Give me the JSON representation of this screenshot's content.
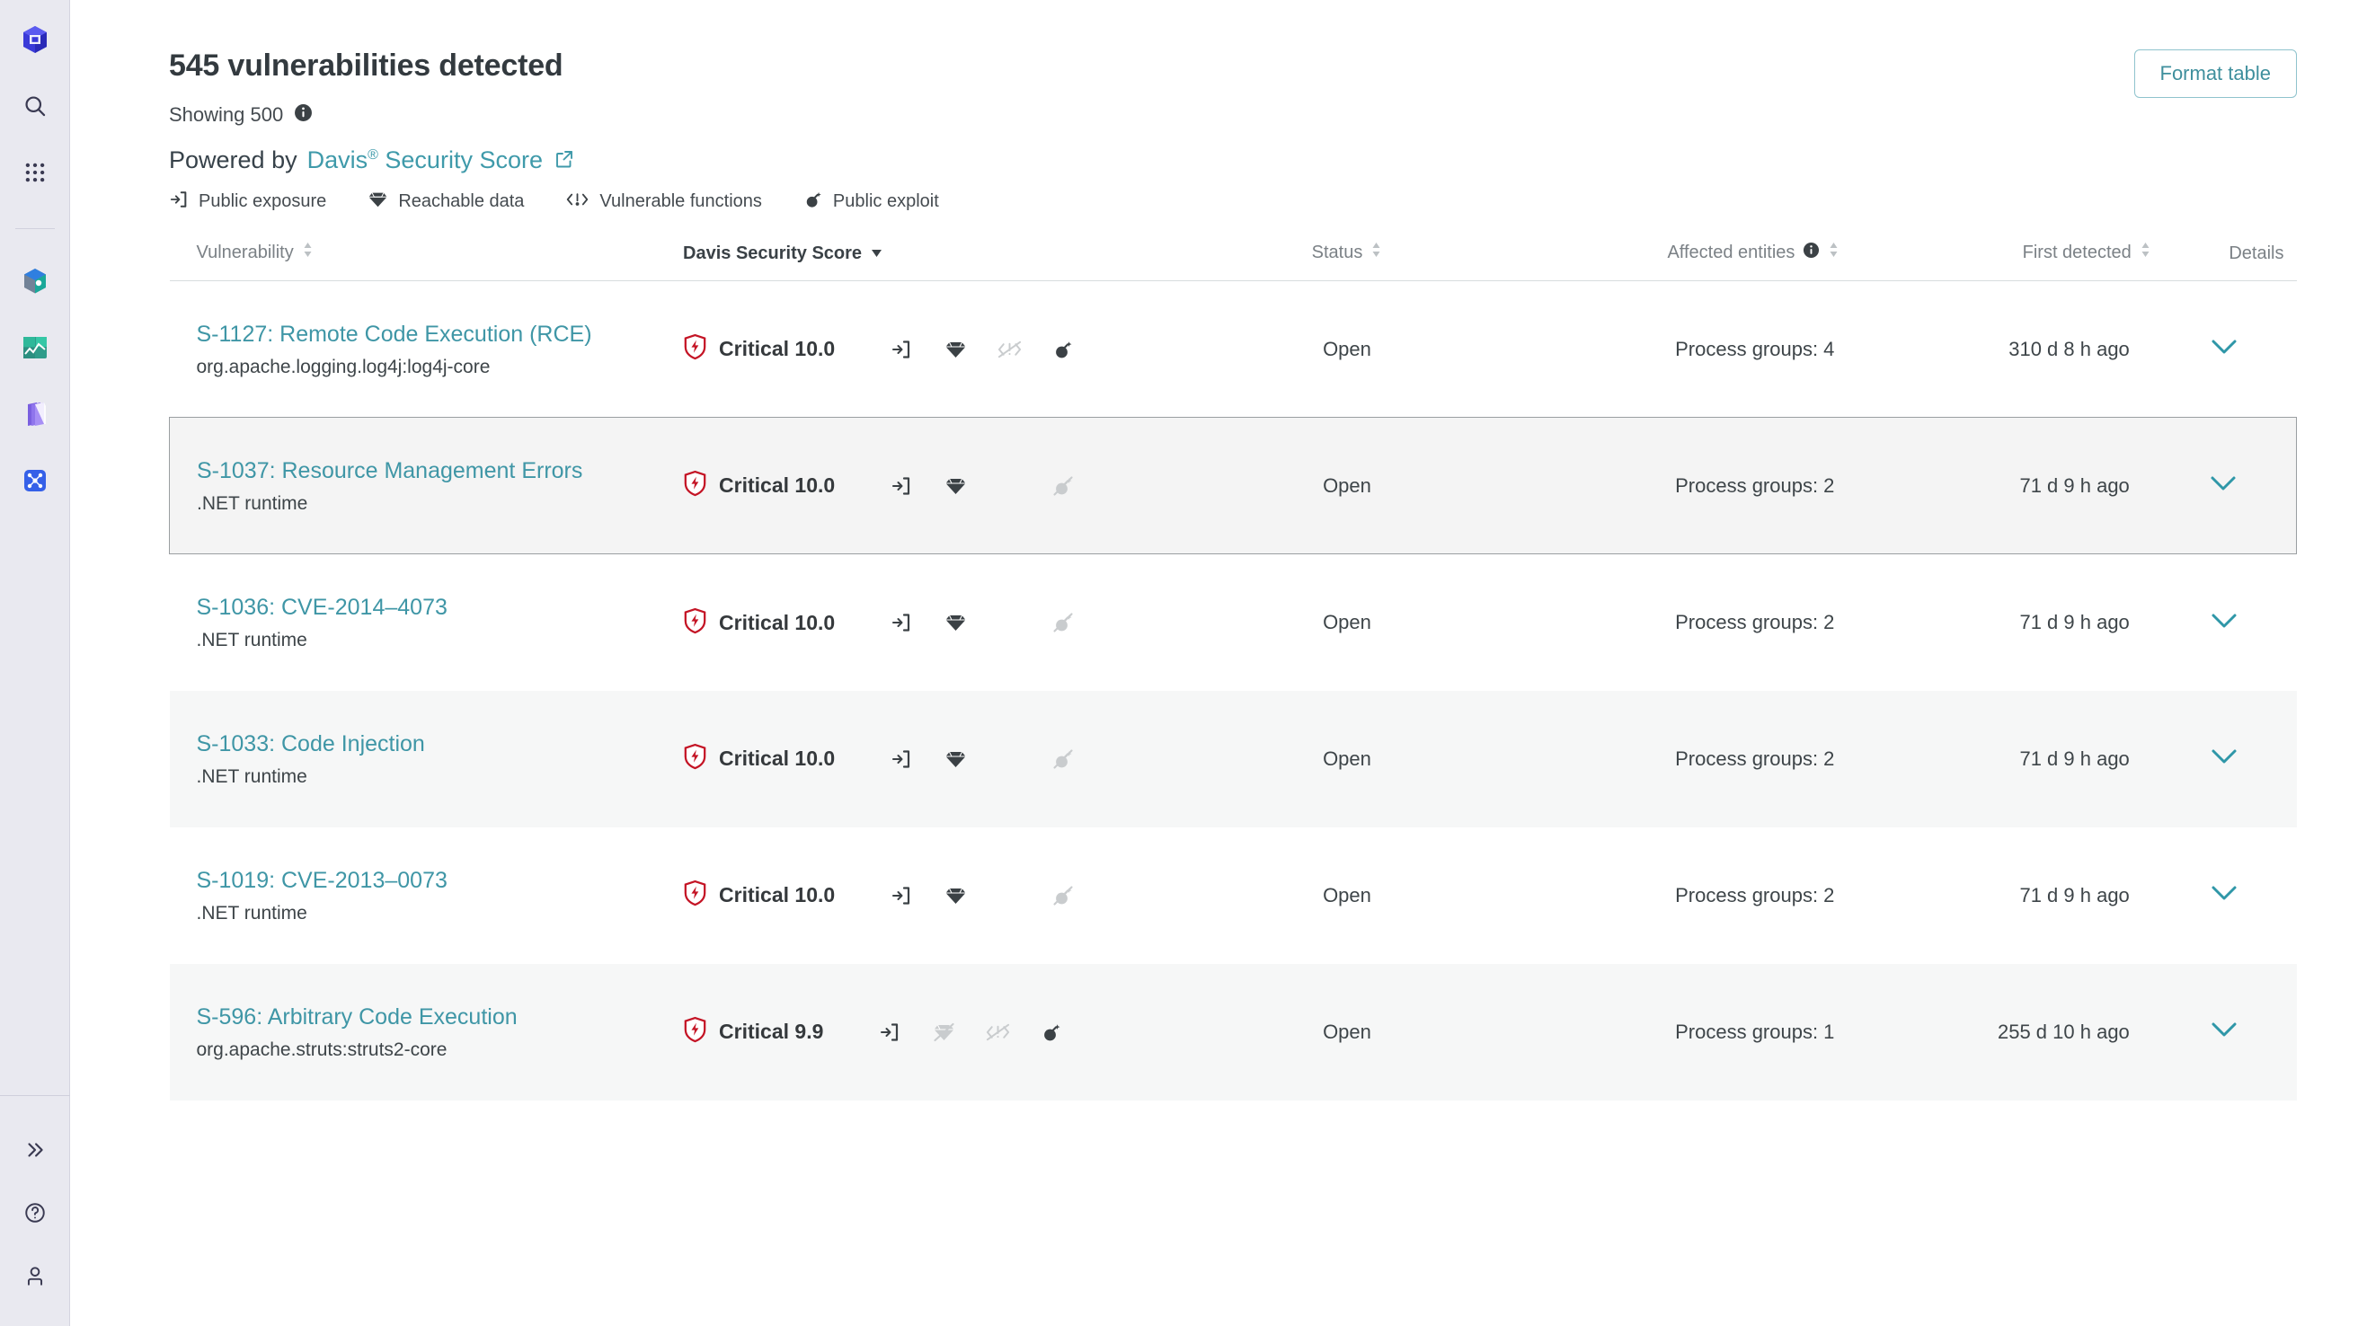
{
  "sidebar": {
    "top_items": [
      {
        "name": "logo-cube-icon",
        "label": "Dynatrace"
      },
      {
        "name": "search-icon",
        "label": "Search"
      },
      {
        "name": "apps-grid-icon",
        "label": "Apps"
      }
    ],
    "pinned_items": [
      {
        "name": "kubernetes-app-icon",
        "label": "Kubernetes"
      },
      {
        "name": "dashboards-app-icon",
        "label": "Dashboards"
      },
      {
        "name": "notebooks-app-icon",
        "label": "Notebooks"
      },
      {
        "name": "security-app-icon",
        "label": "Security"
      }
    ],
    "bottom_items": [
      {
        "name": "expand-chevrons-icon",
        "label": "Expand"
      },
      {
        "name": "help-icon",
        "label": "Help"
      },
      {
        "name": "account-icon",
        "label": "Account"
      }
    ]
  },
  "header": {
    "title": "545 vulnerabilities detected",
    "showing": "Showing 500",
    "showing_info_icon": "info-icon",
    "format_table_label": "Format table",
    "powered_by_label": "Powered by",
    "powered_by_link": "Davis",
    "powered_by_link_sup": "®",
    "powered_by_link_rest": " Security Score",
    "external_link_icon": "external-link-icon"
  },
  "legend": [
    {
      "icon": "public-exposure-icon",
      "label": "Public exposure"
    },
    {
      "icon": "reachable-data-icon",
      "label": "Reachable data"
    },
    {
      "icon": "vulnerable-functions-icon",
      "label": "Vulnerable functions"
    },
    {
      "icon": "public-exploit-icon",
      "label": "Public exploit"
    }
  ],
  "table": {
    "columns": [
      {
        "key": "vulnerability",
        "label": "Vulnerability",
        "sortable": true,
        "sorted": false,
        "align": "left"
      },
      {
        "key": "score",
        "label": "Davis Security Score",
        "sortable": true,
        "sorted": true,
        "sort_dir": "desc",
        "align": "left"
      },
      {
        "key": "status",
        "label": "Status",
        "sortable": true,
        "sorted": false,
        "align": "center"
      },
      {
        "key": "entities",
        "label": "Affected entities",
        "sortable": true,
        "sorted": false,
        "align": "right",
        "info_icon": "info-icon"
      },
      {
        "key": "first_detected",
        "label": "First detected",
        "sortable": true,
        "sorted": false,
        "align": "right"
      },
      {
        "key": "details",
        "label": "Details",
        "sortable": false,
        "sorted": false,
        "align": "center"
      }
    ],
    "rows": [
      {
        "title": "S-1127: Remote Code Execution (RCE)",
        "subtitle": "org.apache.logging.log4j:log4j-core",
        "severity": "Critical",
        "score": "10.0",
        "indicators": {
          "public_exposure": "on",
          "reachable_data": "on",
          "vulnerable_functions": "off",
          "public_exploit": "on"
        },
        "status": "Open",
        "entities": "Process groups: 4",
        "first_detected": "310 d 8 h ago",
        "striped": false,
        "hovered": false
      },
      {
        "title": "S-1037: Resource Management Errors",
        "subtitle": ".NET runtime",
        "severity": "Critical",
        "score": "10.0",
        "indicators": {
          "public_exposure": "on",
          "reachable_data": "on",
          "vulnerable_functions": "none",
          "public_exploit": "off"
        },
        "status": "Open",
        "entities": "Process groups: 2",
        "first_detected": "71 d 9 h ago",
        "striped": true,
        "hovered": true
      },
      {
        "title": "S-1036: CVE-2014–4073",
        "subtitle": ".NET runtime",
        "severity": "Critical",
        "score": "10.0",
        "indicators": {
          "public_exposure": "on",
          "reachable_data": "on",
          "vulnerable_functions": "none",
          "public_exploit": "off"
        },
        "status": "Open",
        "entities": "Process groups: 2",
        "first_detected": "71 d 9 h ago",
        "striped": false,
        "hovered": false
      },
      {
        "title": "S-1033: Code Injection",
        "subtitle": ".NET runtime",
        "severity": "Critical",
        "score": "10.0",
        "indicators": {
          "public_exposure": "on",
          "reachable_data": "on",
          "vulnerable_functions": "none",
          "public_exploit": "off"
        },
        "status": "Open",
        "entities": "Process groups: 2",
        "first_detected": "71 d 9 h ago",
        "striped": true,
        "hovered": false
      },
      {
        "title": "S-1019: CVE-2013–0073",
        "subtitle": ".NET runtime",
        "severity": "Critical",
        "score": "10.0",
        "indicators": {
          "public_exposure": "on",
          "reachable_data": "on",
          "vulnerable_functions": "none",
          "public_exploit": "off"
        },
        "status": "Open",
        "entities": "Process groups: 2",
        "first_detected": "71 d 9 h ago",
        "striped": false,
        "hovered": false
      },
      {
        "title": "S-596: Arbitrary Code Execution",
        "subtitle": "org.apache.struts:struts2-core",
        "severity": "Critical",
        "score": "9.9",
        "indicators": {
          "public_exposure": "on",
          "reachable_data": "off",
          "vulnerable_functions": "off",
          "public_exploit": "on"
        },
        "status": "Open",
        "entities": "Process groups: 1",
        "first_detected": "255 d 10 h ago",
        "striped": true,
        "hovered": false
      }
    ]
  },
  "colors": {
    "link": "#3f96a6",
    "critical": "#c41425",
    "sidebar_bg": "#e9e9f0",
    "stripe": "#f6f7f7",
    "text": "#3e4549",
    "muted": "#7b8186"
  }
}
